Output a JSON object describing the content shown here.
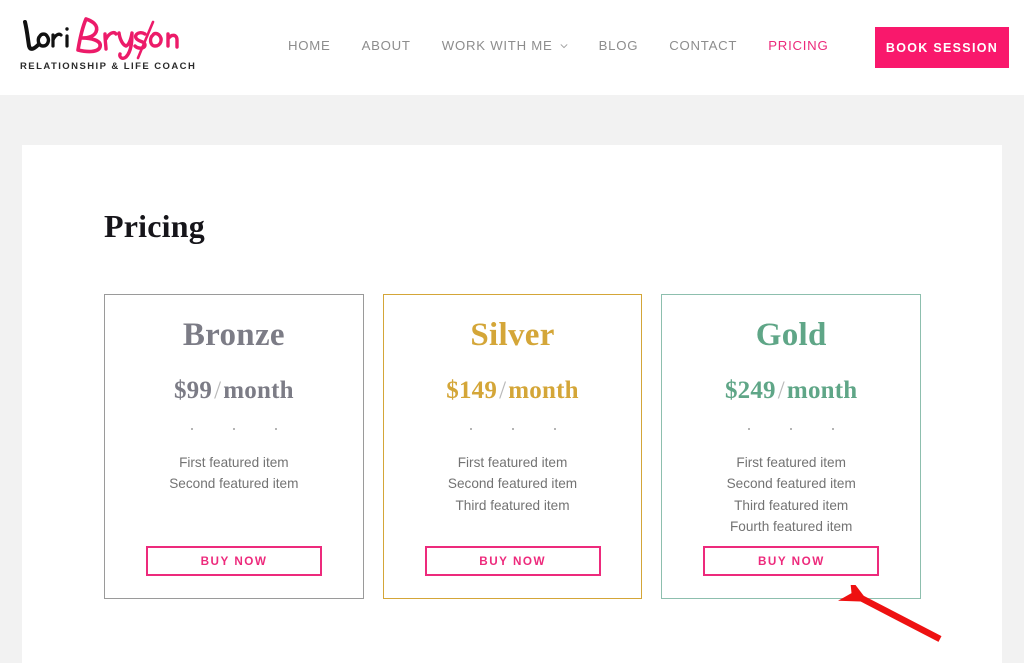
{
  "header": {
    "logo": {
      "name_first": "Lori",
      "name_last": "Bryson",
      "tagline": "RELATIONSHIP & LIFE COACH",
      "color_first": "#111111",
      "color_last": "#ec1b69"
    },
    "nav": [
      {
        "label": "HOME",
        "active": false,
        "has_dropdown": false
      },
      {
        "label": "ABOUT",
        "active": false,
        "has_dropdown": false
      },
      {
        "label": "WORK WITH ME",
        "active": false,
        "has_dropdown": true
      },
      {
        "label": "BLOG",
        "active": false,
        "has_dropdown": false
      },
      {
        "label": "CONTACT",
        "active": false,
        "has_dropdown": false
      },
      {
        "label": "PRICING",
        "active": true,
        "has_dropdown": false
      }
    ],
    "cta": {
      "label": "BOOK SESSION",
      "bg_color": "#f9186c",
      "text_color": "#ffffff"
    }
  },
  "main": {
    "title": "Pricing",
    "plans": [
      {
        "name": "Bronze",
        "price": "$99",
        "separator": "/",
        "period": "month",
        "accent_color": "#7c7c86",
        "border_color": "#9a9a9a",
        "features": [
          "First featured item",
          "Second featured item"
        ],
        "buy_label": "BUY NOW"
      },
      {
        "name": "Silver",
        "price": "$149",
        "separator": "/",
        "period": "month",
        "accent_color": "#d4a638",
        "border_color": "#d4a638",
        "features": [
          "First featured item",
          "Second featured item",
          "Third featured item"
        ],
        "buy_label": "BUY NOW"
      },
      {
        "name": "Gold",
        "price": "$249",
        "separator": "/",
        "period": "month",
        "accent_color": "#5fa687",
        "border_color": "#8dbfae",
        "features": [
          "First featured item",
          "Second featured item",
          "Third featured item",
          "Fourth featured item"
        ],
        "buy_label": "BUY NOW"
      }
    ],
    "buy_button_color": "#ed2a7c"
  },
  "annotation": {
    "type": "arrow",
    "color": "#ee1111",
    "points_to": "gold-plan-buy-now-button"
  }
}
